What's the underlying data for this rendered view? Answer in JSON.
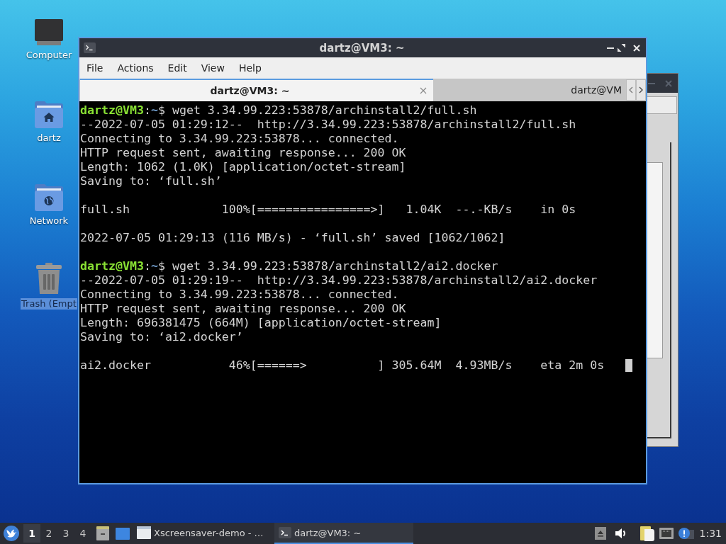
{
  "desktop": {
    "icons": [
      {
        "kind": "computer",
        "label": "Computer",
        "selected": false
      },
      {
        "kind": "home",
        "label": "dartz",
        "selected": false
      },
      {
        "kind": "network",
        "label": "Network",
        "selected": false
      },
      {
        "kind": "trash",
        "label": "Trash (Empt",
        "selected": true
      }
    ]
  },
  "terminal": {
    "title": "dartz@VM3: ~",
    "menu": [
      "File",
      "Actions",
      "Edit",
      "View",
      "Help"
    ],
    "tabs": [
      {
        "label": "dartz@VM3: ~",
        "selected": true
      },
      {
        "label": "dartz@VM",
        "selected": false
      }
    ],
    "cursor_visible": true,
    "lines": [
      {
        "kind": "prompt",
        "user": "dartz@VM3",
        "separator": ":",
        "path": "~",
        "symbol": "$",
        "command": "wget 3.34.99.223:53878/archinstall2/full.sh"
      },
      {
        "kind": "output",
        "text": "--2022-07-05 01:29:12--  http://3.34.99.223:53878/archinstall2/full.sh"
      },
      {
        "kind": "output",
        "text": "Connecting to 3.34.99.223:53878... connected."
      },
      {
        "kind": "output",
        "text": "HTTP request sent, awaiting response... 200 OK"
      },
      {
        "kind": "output",
        "text": "Length: 1062 (1.0K) [application/octet-stream]"
      },
      {
        "kind": "output",
        "text": "Saving to: ‘full.sh’"
      },
      {
        "kind": "blank"
      },
      {
        "kind": "output",
        "text": "full.sh             100%[================>]   1.04K  --.-KB/s    in 0s"
      },
      {
        "kind": "blank"
      },
      {
        "kind": "output",
        "text": "2022-07-05 01:29:13 (116 MB/s) - ‘full.sh’ saved [1062/1062]"
      },
      {
        "kind": "blank"
      },
      {
        "kind": "prompt",
        "user": "dartz@VM3",
        "separator": ":",
        "path": "~",
        "symbol": "$",
        "command": "wget 3.34.99.223:53878/archinstall2/ai2.docker"
      },
      {
        "kind": "output",
        "text": "--2022-07-05 01:29:19--  http://3.34.99.223:53878/archinstall2/ai2.docker"
      },
      {
        "kind": "output",
        "text": "Connecting to 3.34.99.223:53878... connected."
      },
      {
        "kind": "output",
        "text": "HTTP request sent, awaiting response... 200 OK"
      },
      {
        "kind": "output",
        "text": "Length: 696381475 (664M) [application/octet-stream]"
      },
      {
        "kind": "output",
        "text": "Saving to: ‘ai2.docker’"
      },
      {
        "kind": "blank"
      },
      {
        "kind": "output",
        "text": "ai2.docker           46%[======>          ] 305.64M  4.93MB/s    eta 2m 0s"
      }
    ]
  },
  "taskbar": {
    "workspaces": [
      {
        "label": "1",
        "selected": true
      },
      {
        "label": "2",
        "selected": false
      },
      {
        "label": "3",
        "selected": false
      },
      {
        "label": "4",
        "selected": false
      }
    ],
    "tasks": [
      {
        "kind": "window",
        "label": "Xscreensaver-demo - …",
        "selected": false
      },
      {
        "kind": "terminal",
        "label": "dartz@VM3: ~",
        "selected": true
      }
    ],
    "clock": "1:31"
  }
}
